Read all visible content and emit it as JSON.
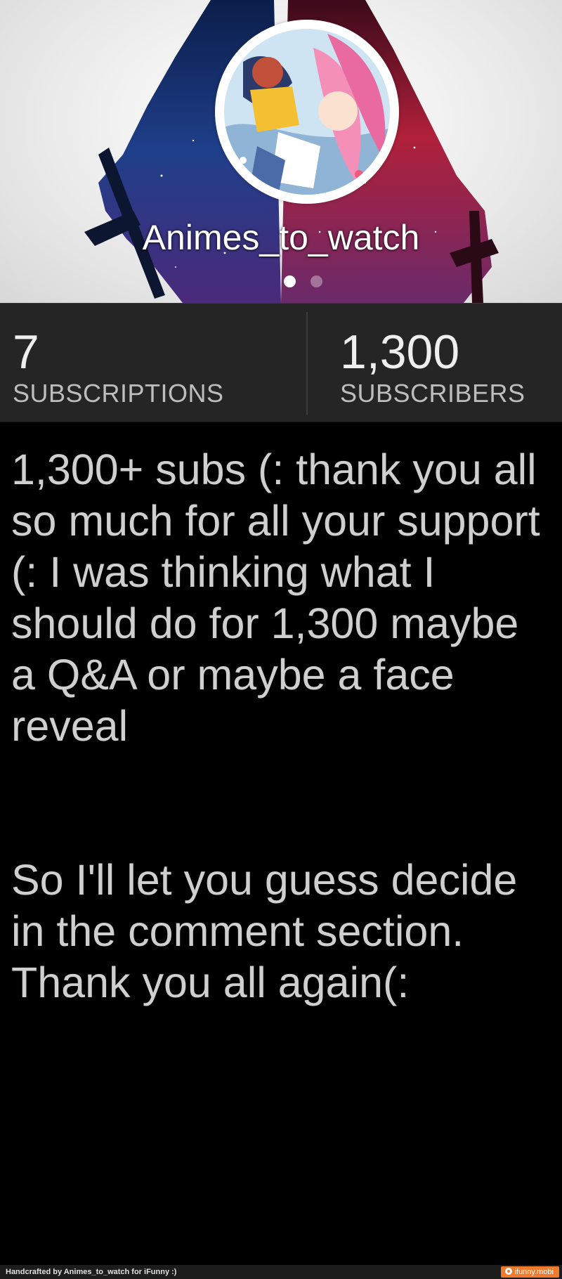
{
  "profile": {
    "username": "Animes_to_watch",
    "pager_total": 2,
    "pager_active": 1
  },
  "stats": {
    "subscriptions_count": "7",
    "subscriptions_label": "SUBSCRIPTIONS",
    "subscribers_count": "1,300",
    "subscribers_label": "SUBSCRIBERS"
  },
  "post": {
    "paragraph_1": "1,300+ subs (: thank you all so much for all your support (: I was thinking what I should do for 1,300 maybe a Q&A or maybe a face reveal",
    "paragraph_2": "So I'll let you guess decide in the comment section.\nThank you all again(:"
  },
  "footer": {
    "credit": "Handcrafted by Animes_to_watch for iFunny :)",
    "badge": "ifunny.mobi"
  },
  "colors": {
    "stats_background": "#252525",
    "page_background": "#000000",
    "post_text": "#cfcfcf",
    "badge_orange": "#f07a2e"
  },
  "icons": {
    "avatar": "anime-avatar",
    "badge": "ifunny-logo-icon"
  }
}
